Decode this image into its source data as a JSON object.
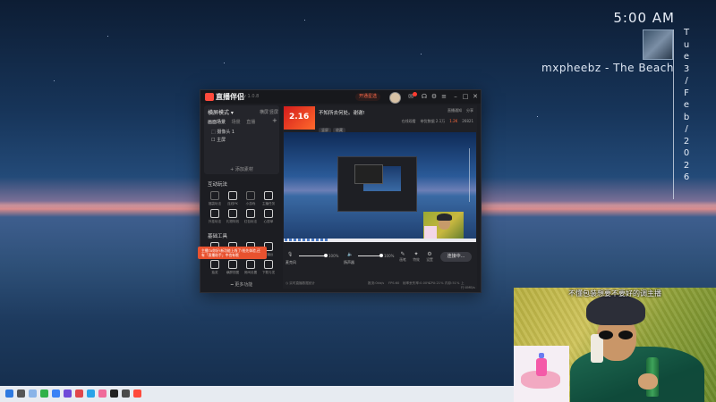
{
  "desktop": {
    "clock": "5:00 AM",
    "now_playing": "mxpheebz - The Beach",
    "vertical_date": [
      "T",
      "u",
      "e",
      "3",
      "/",
      "F",
      "e",
      "b",
      "/",
      "2",
      "0",
      "2",
      "6"
    ]
  },
  "app": {
    "name": "直播伴侣",
    "version": "v 1.0.8",
    "vip_label": "开通星选",
    "vip_badge": "NEW",
    "left": {
      "scene_title": "横屏模式 ▾",
      "scene_actions": [
        "横屏",
        "竖屏"
      ],
      "tabs": [
        "画面场景",
        "场景",
        "直播"
      ],
      "sources": [
        "⬚ 摄像头 1",
        "☐ 主屏"
      ],
      "add_source": "+ 添加素材",
      "section_interact": "互动玩法",
      "interact_items": [
        "福袋玩法",
        "连线PK",
        "小游戏",
        "主播任务",
        "外挂玩法",
        "礼物特效",
        "红包玩法",
        "心愿单"
      ],
      "section_tools": "基础工具",
      "tool_items": [
        "美颜",
        "音效",
        "投屏",
        "主播台",
        "抽奖",
        "横屏视图",
        "房间设置",
        "下载与发"
      ],
      "more": "━ 更多功能",
      "toast": "主播TA你好!新功能上线了!抢先体验,还有「直播助手」中也有哦"
    },
    "right": {
      "thumb_text": "2.16",
      "title": "不知所去何处。谢谢!",
      "pills": [
        "竖屏",
        "收藏"
      ],
      "tools": [
        "直播通知",
        "分享"
      ],
      "stats": [
        "在线观看",
        "带货数据 2.1万",
        "1.2K",
        "26821"
      ],
      "controls": {
        "mic_label": "麦克风",
        "mic_pct": "100%",
        "spk_label": "扬声器",
        "spk_pct": "100%",
        "btns": [
          {
            "glyph": "✎",
            "label": "画笔"
          },
          {
            "glyph": "✦",
            "label": "特效"
          },
          {
            "glyph": "⚙",
            "label": "设置"
          }
        ],
        "go_live": "连接中..."
      },
      "status": [
        "◷ 实时直播数据统计",
        "推流:0kb/s",
        "FPS:60",
        "帧率丢失率:0.00%",
        "CPU:21%",
        "内存:51%",
        "上行:0MB/s"
      ]
    }
  },
  "webcam": {
    "caption": "不懂包装想要不要好的调主播"
  },
  "colors": {
    "accent": "#ff4a3c",
    "toast": "#e8522f",
    "live_hot": "#ff6a3c"
  }
}
